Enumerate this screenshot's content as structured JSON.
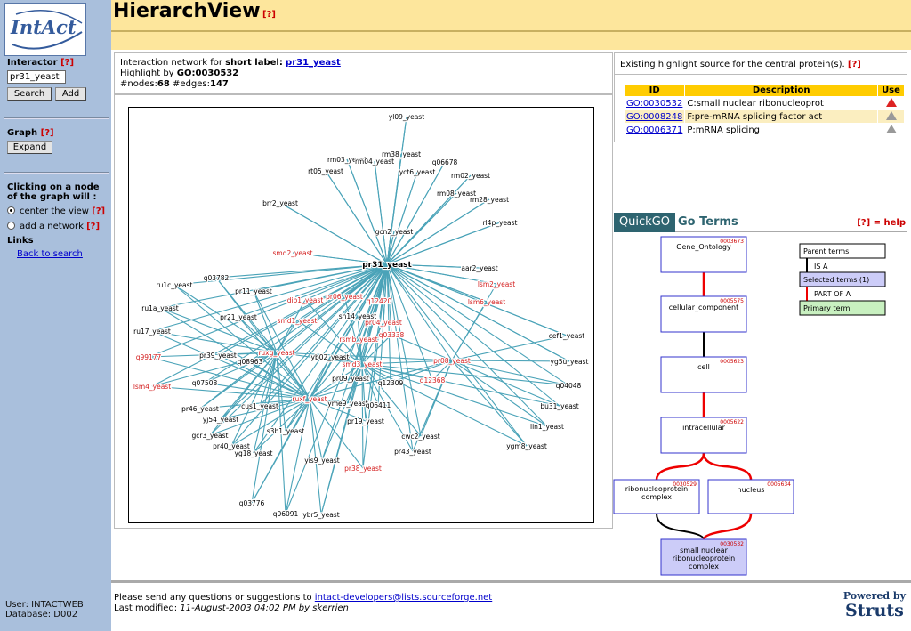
{
  "sidebar": {
    "logo_text": "IntAct",
    "interactor_label": "Interactor",
    "help": "[?]",
    "interactor_value": "pr31_yeast",
    "search_label": "Search",
    "add_label": "Add",
    "graph_label": "Graph",
    "expand_label": "Expand",
    "click_label": "Clicking on a node of the graph will :",
    "opt_center": "center the view",
    "opt_add": "add a network",
    "links_label": "Links",
    "back_link": "Back to search",
    "user": "User: INTACTWEB",
    "database": "Database: D002"
  },
  "header": {
    "title": "HierarchView",
    "help": "[?]"
  },
  "info": {
    "line1_prefix": "Interaction network for",
    "line1_bold": "short label:",
    "line1_link": "pr31_yeast",
    "line2_prefix": "Highlight by",
    "line2_bold": "GO:0030532",
    "nodes_label": "#nodes:",
    "nodes": "68",
    "edges_label": "#edges:",
    "edges": "147"
  },
  "highlight": {
    "header": "Existing highlight source for the central protein(s).",
    "help": "[?]",
    "columns": [
      "ID",
      "Description",
      "Use"
    ],
    "rows": [
      {
        "id": "GO:0030532",
        "desc": "C:small nuclear ribonucleoprot",
        "use": "red-warning-icon"
      },
      {
        "id": "GO:0008248",
        "desc": "F:pre-mRNA splicing factor act",
        "use": "grey-warning-icon"
      },
      {
        "id": "GO:0006371",
        "desc": "P:mRNA splicing",
        "use": "grey-warning-icon"
      }
    ]
  },
  "quickgo": {
    "badge": "QuickGO",
    "title": "Go Terms",
    "help": "[?] = help",
    "legend": {
      "parent": "Parent terms",
      "isa": "IS A",
      "selected": "Selected terms (1)",
      "partof": "PART OF A",
      "primary": "Primary term"
    },
    "terms": [
      {
        "id": "0003673",
        "name": "Gene_Ontology"
      },
      {
        "id": "0005575",
        "name": "cellular_component"
      },
      {
        "id": "0005623",
        "name": "cell"
      },
      {
        "id": "0005622",
        "name": "intracellular"
      },
      {
        "id": "0030529",
        "name": "ribonucleoprotein complex"
      },
      {
        "id": "0005634",
        "name": "nucleus"
      },
      {
        "id": "0030532",
        "name": "small nuclear ribonucleoprotein complex"
      }
    ]
  },
  "graph": {
    "central": "pr31_yeast",
    "highlighted": [
      "smd2_yeast",
      "pr06_yeast",
      "dib1_yeast",
      "lsm2_yeast",
      "lsm6_yeast",
      "q12420",
      "smd1_yeast",
      "pr04_yeast",
      "rsmb_yeast",
      "q03338",
      "ruxg_yeast",
      "pr08_yeast",
      "q99177",
      "smd3_yeast",
      "q12368",
      "lsm4_yeast",
      "ruxf_yeast",
      "pr38_yeast"
    ],
    "nodes": [
      "yl09_yeast",
      "rm38_yeast",
      "rm03_yeast",
      "rm04_yeast",
      "q06678",
      "rt05_yeast",
      "yct6_yeast",
      "rm02_yeast",
      "rm08_yeast",
      "rm28_yeast",
      "brr2_yeast",
      "rl4p_yeast",
      "gcn2_yeast",
      "smd2_yeast",
      "pr31_yeast",
      "aar2_yeast",
      "q03782",
      "lsm2_yeast",
      "ru1c_yeast",
      "pr11_yeast",
      "dib1_yeast",
      "pr06_yeast",
      "q12420",
      "lsm6_yeast",
      "ru1a_yeast",
      "pr21_yeast",
      "smd1_yeast",
      "sn14_yeast",
      "pr04_yeast",
      "ru17_yeast",
      "rsmb_yeast",
      "q03338",
      "cef1_yeast",
      "pr39_yeast",
      "ruxg_yeast",
      "yb02_yeast",
      "q99177",
      "q08963",
      "pr08_yeast",
      "yg5u_yeast",
      "smd3_yeast",
      "q07508",
      "pr09_yeast",
      "q12309",
      "lsm4_yeast",
      "q12368",
      "q04048",
      "ruxf_yeast",
      "pr46_yeast",
      "cus1_yeast",
      "yme9_yeast",
      "q06411",
      "bu31_yeast",
      "yj54_yeast",
      "pr19_yeast",
      "lin1_yeast",
      "gcr3_yeast",
      "s3b1_yeast",
      "cwc2_yeast",
      "pr40_yeast",
      "yg18_yeast",
      "pr43_yeast",
      "ygm8_yeast",
      "yis9_yeast",
      "pr38_yeast",
      "q03776",
      "q06091",
      "ybr5_yeast"
    ]
  },
  "footer": {
    "line1_prefix": "Please send any questions or suggestions to",
    "email": "intact-developers@lists.sourceforge.net",
    "line2_prefix": "Last modified:",
    "modified": "11-August-2003 04:02 PM by skerrien",
    "powered1": "Powered by",
    "powered2": "Struts"
  },
  "colors": {
    "header_bg": "#fde69c",
    "sidebar_bg": "#a9bfdc",
    "edge": "#4aa3b8",
    "highlight_text": "#d42020",
    "table_header": "#ffcc00"
  }
}
